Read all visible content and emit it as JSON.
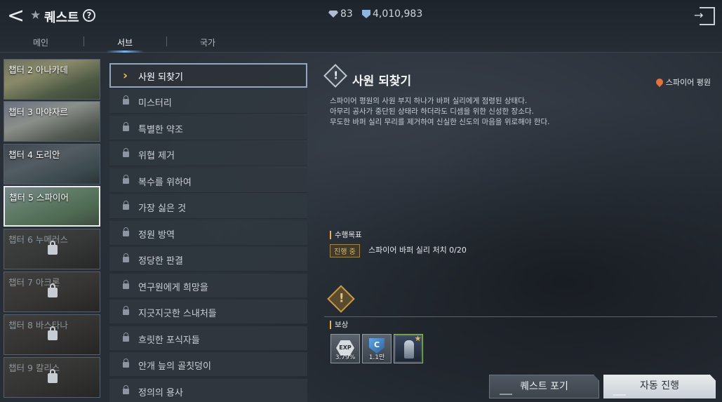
{
  "header": {
    "title": "퀘스트",
    "currency_1": "83",
    "currency_2": "4,010,983",
    "tabs": [
      {
        "label": "메인"
      },
      {
        "label": "서브"
      },
      {
        "label": "국가"
      }
    ]
  },
  "chapters": [
    {
      "label": "챕터 2 아나카데",
      "locked": false
    },
    {
      "label": "챕터 3 마야자르",
      "locked": false
    },
    {
      "label": "챕터 4 도리안",
      "locked": false
    },
    {
      "label": "챕터 5 스파이어",
      "locked": false
    },
    {
      "label": "챕터 6 누메러스",
      "locked": true
    },
    {
      "label": "챕터 7 아크론",
      "locked": true
    },
    {
      "label": "챕터 8 바스타나",
      "locked": true
    },
    {
      "label": "챕터 9 칼리스",
      "locked": true
    }
  ],
  "quests": [
    {
      "label": "사원 되찾기"
    },
    {
      "label": "미스터리"
    },
    {
      "label": "특별한 약조"
    },
    {
      "label": "위협 제거"
    },
    {
      "label": "복수를 위하여"
    },
    {
      "label": "가장 싫은 것"
    },
    {
      "label": "정원 방역"
    },
    {
      "label": "정당한 판결"
    },
    {
      "label": "연구원에게 희망을"
    },
    {
      "label": "지긋지긋한 스내처들"
    },
    {
      "label": "흐릿한 포식자들"
    },
    {
      "label": "안개 늪의 골칫덩이"
    },
    {
      "label": "정의의 용사"
    }
  ],
  "detail": {
    "title": "사원 되찾기",
    "location": "스파이어 평원",
    "description": [
      "스파이어 평원의 사원 부지 하나가 바퍼 실리에게 점령된 상태다.",
      "아무리 공사가 중단된 상태라 하더라도 디셈을 위한 신성한 장소다.",
      "무도한 바퍼 실리 무리를 제거하여 신실한 신도의 마음을 위로해야 한다."
    ],
    "objective_heading": "수행목표",
    "status_badge": "진행 중",
    "objective": "스파이어 바퍼 실리 처치 0/20",
    "reward_heading": "보상",
    "rewards": [
      {
        "icon": "EXP",
        "label": "3.79%"
      },
      {
        "icon": "C",
        "label": "1.1만"
      },
      {
        "icon": "character-card",
        "label": ""
      }
    ]
  },
  "buttons": {
    "give_up": "퀘스트 포기",
    "auto": "자동 진행"
  },
  "colors": {
    "accent": "#f0b84a",
    "active_border": "#8fa7bf"
  }
}
